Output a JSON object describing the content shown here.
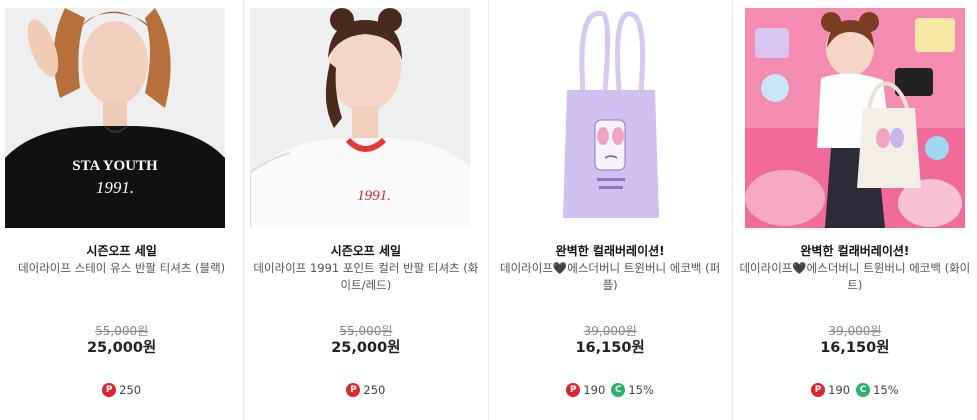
{
  "colors": {
    "point_badge": "#e0252f",
    "coupon_badge": "#26b36a",
    "strike_price": "#888888",
    "price": "#222222"
  },
  "products": [
    {
      "promo": "시즌오프 세일",
      "name": "데이라이프 스테이 유스 반팔 티셔츠 (블랙)",
      "original_price": "55,000원",
      "price": "25,000원",
      "point_icon": "P",
      "points": "250",
      "coupon_icon": "",
      "coupon": "",
      "image": "model-black-tshirt-photo"
    },
    {
      "promo": "시즌오프 세일",
      "name": "데이라이프 1991 포인트 컬러 반팔 티셔츠 (화이트/레드)",
      "original_price": "55,000원",
      "price": "25,000원",
      "point_icon": "P",
      "points": "250",
      "coupon_icon": "",
      "coupon": "",
      "image": "model-white-red-tshirt-photo"
    },
    {
      "promo": "완벽한 컬래버레이션!",
      "name": "데이라이프🖤에스더버니 트윈버니 에코백 (퍼플)",
      "original_price": "39,000원",
      "price": "16,150원",
      "point_icon": "P",
      "points": "190",
      "coupon_icon": "C",
      "coupon": "15%",
      "image": "purple-tote-bag-photo"
    },
    {
      "promo": "완벽한 컬래버레이션!",
      "name": "데이라이프🖤에스더버니 트윈버니 에코백 (화이트)",
      "original_price": "39,000원",
      "price": "16,150원",
      "point_icon": "P",
      "points": "190",
      "coupon_icon": "C",
      "coupon": "15%",
      "image": "model-white-tote-bag-photo"
    }
  ]
}
